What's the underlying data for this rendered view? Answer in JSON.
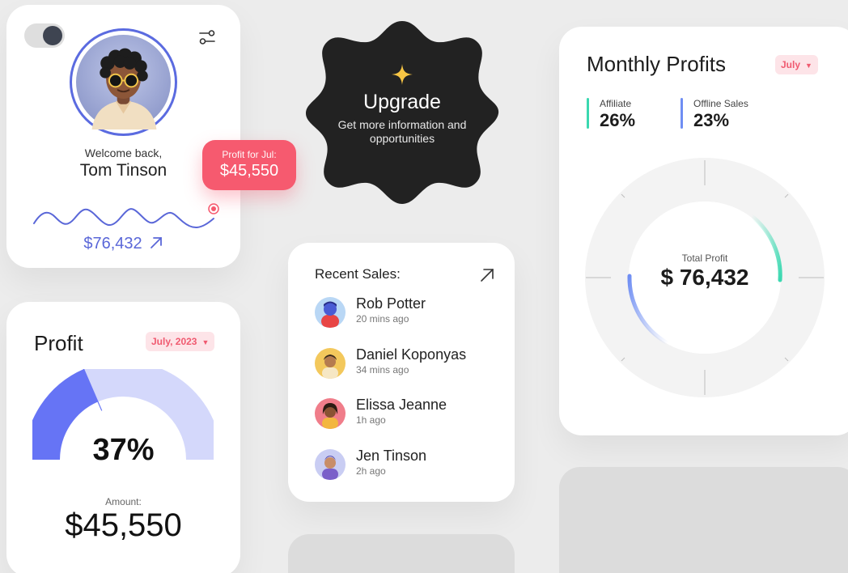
{
  "profile_card": {
    "welcome": "Welcome back,",
    "name": "Tom Tinson",
    "total": "$76,432",
    "icons": {
      "toggle": "theme-toggle",
      "settings": "sliders-icon",
      "trend": "arrow-up-right-icon"
    }
  },
  "profit_bubble": {
    "label": "Profit for Jul:",
    "value": "$45,550"
  },
  "upgrade": {
    "title": "Upgrade",
    "subtitle": "Get more information and opportunities",
    "icon": "sparkle-icon",
    "colors": {
      "badge": "#222222",
      "star": "#f7c544"
    }
  },
  "recent_sales": {
    "title": "Recent Sales:",
    "items": [
      {
        "name": "Rob Potter",
        "time": "20 mins ago"
      },
      {
        "name": "Daniel Koponyas",
        "time": "34 mins ago"
      },
      {
        "name": "Elissa Jeanne",
        "time": "1h ago"
      },
      {
        "name": "Jen Tinson",
        "time": "2h ago"
      }
    ]
  },
  "profit_card": {
    "title": "Profit",
    "period": "July, 2023",
    "percent": "37%",
    "percent_value": 0.37,
    "amount_label": "Amount:",
    "amount": "$45,550",
    "colors": {
      "filled": "#6674f5",
      "track": "#d4d8fb"
    }
  },
  "monthly_profits": {
    "title": "Monthly Profits",
    "period": "July",
    "legend": [
      {
        "label": "Affiliate",
        "value": "26%",
        "color": "#3ad8b0"
      },
      {
        "label": "Offline Sales",
        "value": "23%",
        "color": "#6f8ef3"
      }
    ],
    "total_label": "Total Profit",
    "total_value": "$ 76,432"
  },
  "colors": {
    "accent": "#5a67d8",
    "pink": "#f65a6f",
    "background": "#ececec"
  }
}
